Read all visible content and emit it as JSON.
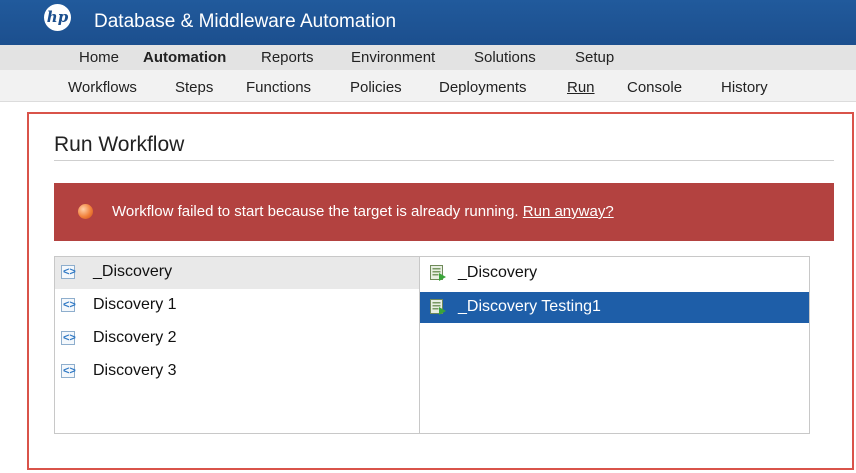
{
  "header": {
    "logo_text": "hp",
    "app_title": "Database & Middleware Automation"
  },
  "main_nav": [
    {
      "label": "Home"
    },
    {
      "label": "Automation"
    },
    {
      "label": "Reports"
    },
    {
      "label": "Environment"
    },
    {
      "label": "Solutions"
    },
    {
      "label": "Setup"
    }
  ],
  "sub_nav": [
    {
      "label": "Workflows"
    },
    {
      "label": "Steps"
    },
    {
      "label": "Functions"
    },
    {
      "label": "Policies"
    },
    {
      "label": "Deployments"
    },
    {
      "label": "Run"
    },
    {
      "label": "Console"
    },
    {
      "label": "History"
    }
  ],
  "active_main_nav": "Automation",
  "active_sub_nav": "Run",
  "page": {
    "title": "Run Workflow"
  },
  "alert": {
    "message": "Workflow failed to start because the target is already running. ",
    "link": "Run anyway?",
    "color": "#b34240"
  },
  "workflows": {
    "selected": "_Discovery",
    "items": [
      {
        "label": "_Discovery",
        "icon": "workflow-icon"
      },
      {
        "label": "Discovery 1",
        "icon": "workflow-icon"
      },
      {
        "label": "Discovery 2",
        "icon": "workflow-icon"
      },
      {
        "label": "Discovery 3",
        "icon": "workflow-icon"
      }
    ]
  },
  "targets": {
    "selected": "_Discovery Testing1",
    "items": [
      {
        "label": "_Discovery",
        "icon": "target-icon"
      },
      {
        "label": "_Discovery Testing1",
        "icon": "target-icon"
      }
    ]
  },
  "colors": {
    "header": "#1c4f8e",
    "selection": "#1e5ea8",
    "frame_highlight": "#d9534a"
  }
}
